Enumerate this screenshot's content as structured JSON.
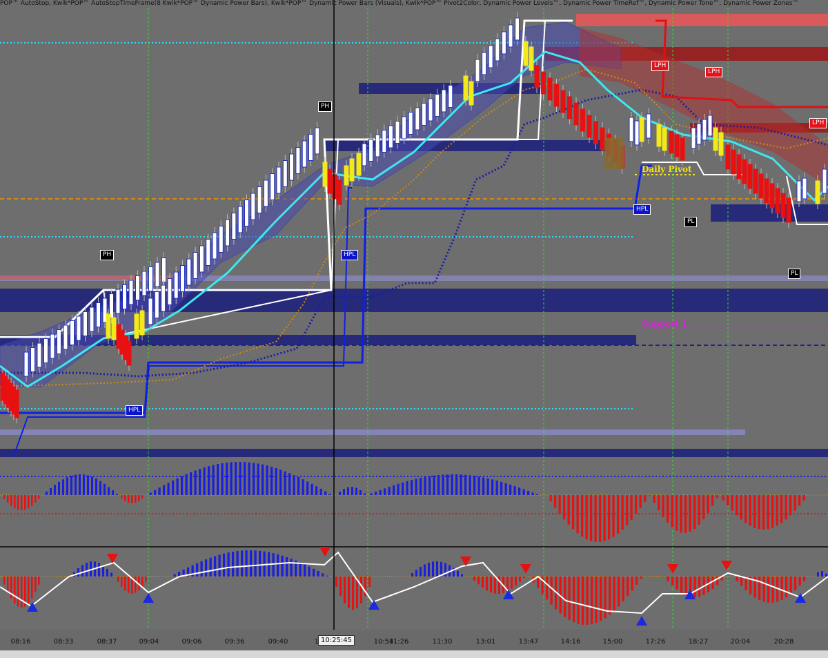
{
  "header": {
    "indicators": "POP™ AutoStop, Kwik*POP™ AutoStopTimeFrame(8 Kwik*POP™ Dynamic Power Bars), Kwik*POP™ Dynamic Power Bars (Visuals), Kwik*POP™ Pivot2Color, Dynamic Power Levels™, Dynamic Power TimeRef™, Dynamic Power Tone™, Dynamic Power Zones™"
  },
  "chart_data": {
    "type": "candlestick",
    "x_tick_labels": [
      "08:16",
      "08:33",
      "08:37",
      "09:04",
      "09:06",
      "09:36",
      "09:40",
      "10",
      "10:54",
      "11:26",
      "11:30",
      "13:01",
      "13:47",
      "14:16",
      "15:00",
      "17:26",
      "18:27",
      "20:04",
      "20:28"
    ],
    "crosshair_time": "10:25:45",
    "pivot_labels": [
      {
        "text": "PH",
        "style": "black"
      },
      {
        "text": "PH",
        "style": "black"
      },
      {
        "text": "HPL",
        "style": "blue"
      },
      {
        "text": "HPL",
        "style": "blue"
      },
      {
        "text": "HPL",
        "style": "blue"
      },
      {
        "text": "PL",
        "style": "black"
      },
      {
        "text": "PL",
        "style": "black"
      },
      {
        "text": "LPH",
        "style": "red"
      },
      {
        "text": "LPH",
        "style": "red"
      },
      {
        "text": "LPH",
        "style": "red"
      }
    ],
    "level_labels": [
      {
        "text": "Daily Pivot",
        "color": "#f4e21a"
      },
      {
        "text": "Support 1",
        "color": "#e020e0"
      }
    ],
    "colors": {
      "background": "#6e6e6e",
      "bull_bar": "#ffffff",
      "bear_bar": "#e81010",
      "neutral_bar": "#f2e81a",
      "ma_line": "#3ee8f0",
      "zone_blue": "#1a1f7a",
      "zone_red": "#a01010",
      "level_cyan": "#28e0ff",
      "level_orange": "#d58a10",
      "level_magenta": "#e020e0",
      "osc_pos": "#1a1ee0",
      "osc_neg": "#e81010",
      "time_ref": "#30e030"
    },
    "grid": false
  }
}
